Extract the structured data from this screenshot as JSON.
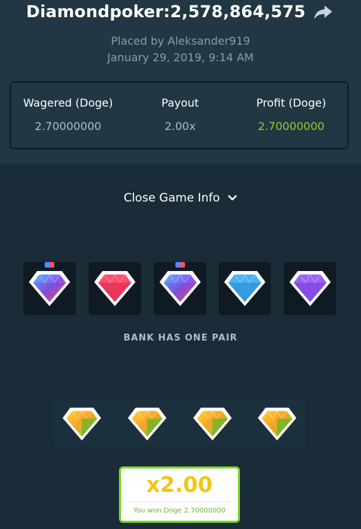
{
  "header": {
    "title": "Diamondpoker:2,578,864,575",
    "placed_by": "Placed by Aleksander919",
    "date": "January 29, 2019, 9:14 AM"
  },
  "stats": [
    {
      "label": "Wagered (Doge)",
      "value": "2.70000000"
    },
    {
      "label": "Payout",
      "value": "2.00x"
    },
    {
      "label": "Profit (Doge)",
      "value": "2.70000000"
    }
  ],
  "toggle": {
    "label": "Close Game Info"
  },
  "bank": {
    "gems": [
      "blue-purple-red-gem",
      "red-gem",
      "blue-purple-red-gem",
      "blue-gem",
      "purple-gem"
    ],
    "result": "BANK HAS ONE PAIR"
  },
  "player": {
    "gems": [
      "yellow-green-gem",
      "yellow-green-gem",
      "yellow-green-gem",
      "yellow-green-gem"
    ]
  },
  "result": {
    "multiplier": "x2.00",
    "message": "You won Doge 2.70000000"
  },
  "colors": {
    "profit": "#8ad32a",
    "win_border": "#7bd424",
    "multiplier": "#f2c618"
  }
}
